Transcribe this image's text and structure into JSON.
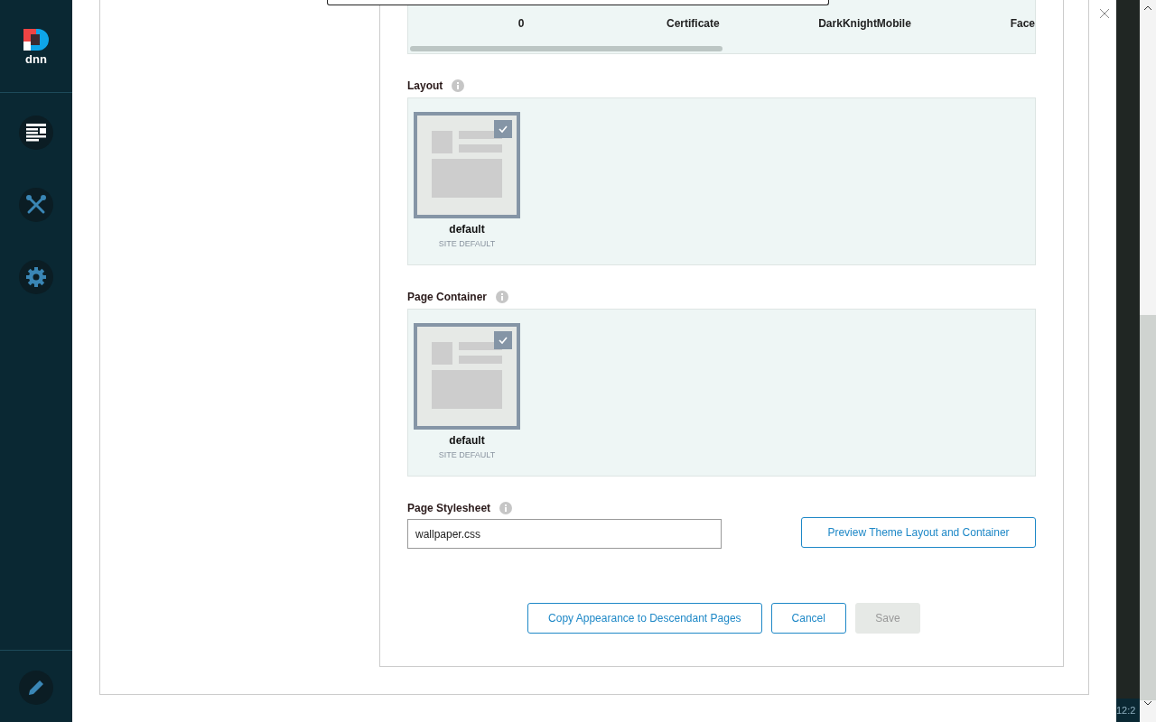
{
  "sidebar": {
    "logo_text": "dnn",
    "items": [
      {
        "kind": "pages",
        "selected": true
      },
      {
        "kind": "tools",
        "selected": false
      },
      {
        "kind": "settings",
        "selected": false
      }
    ]
  },
  "theme_strip": {
    "themes": [
      "0",
      "Certificate",
      "DarkKnightMobile",
      "Face"
    ]
  },
  "sections": [
    {
      "label": "Layout",
      "tiles": [
        {
          "name": "default",
          "caption": "SITE DEFAULT",
          "selected": true
        }
      ]
    },
    {
      "label": "Page Container",
      "tiles": [
        {
          "name": "default",
          "caption": "SITE DEFAULT",
          "selected": true
        }
      ]
    }
  ],
  "stylesheet": {
    "label": "Page Stylesheet",
    "value": "wallpaper.css"
  },
  "preview_button": "Preview Theme Layout and Container",
  "actions": [
    {
      "label": "Copy Appearance to Descendant Pages",
      "disabled": false
    },
    {
      "label": "Cancel",
      "disabled": false
    },
    {
      "label": "Save",
      "disabled": true
    }
  ],
  "taskbar_clock": "12:2"
}
